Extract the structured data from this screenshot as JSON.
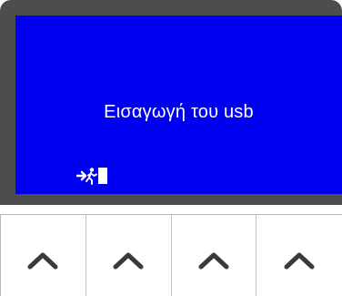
{
  "screen": {
    "message": "Εισαγωγή του usb",
    "background_color": "#0000f0",
    "text_color": "#ffffff",
    "status_icon": "exit-icon"
  },
  "bezel": {
    "color": "#4d4d4d"
  },
  "soft_keys": [
    {
      "icon": "chevron-up-icon"
    },
    {
      "icon": "chevron-up-icon"
    },
    {
      "icon": "chevron-up-icon"
    },
    {
      "icon": "chevron-up-icon"
    }
  ]
}
